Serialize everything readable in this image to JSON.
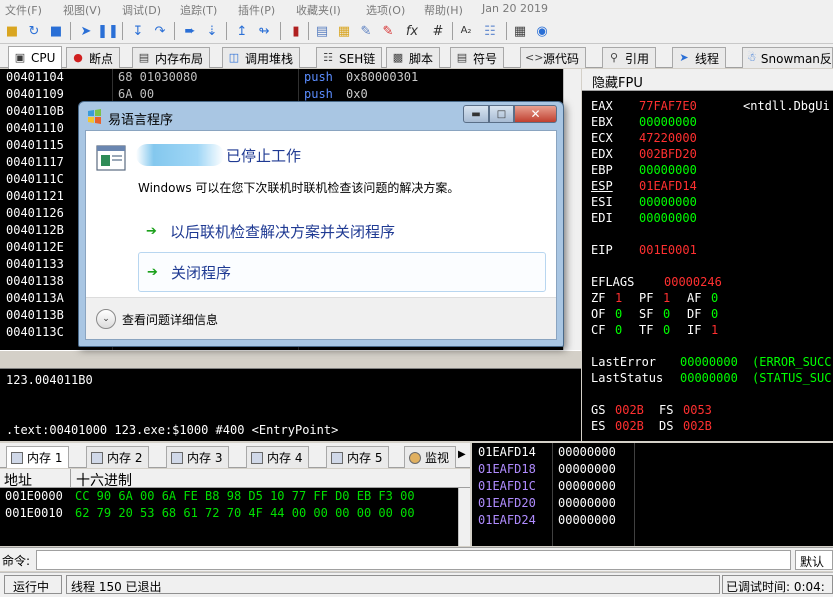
{
  "menu": {
    "items": [
      "文件(F)",
      "视图(V)",
      "调试(D)",
      "追踪(T)",
      "插件(P)",
      "收藏夹(I)",
      "选项(O)",
      "帮助(H)",
      "Jan 20 2019"
    ]
  },
  "tabs": [
    {
      "label": "CPU",
      "icon": "cpu-icon"
    },
    {
      "label": "断点",
      "icon": "breakpoint-icon"
    },
    {
      "label": "内存布局",
      "icon": "memory-map-icon"
    },
    {
      "label": "调用堆栈",
      "icon": "call-stack-icon"
    },
    {
      "label": "SEH链",
      "icon": "seh-icon"
    },
    {
      "label": "脚本",
      "icon": "script-icon"
    },
    {
      "label": "符号",
      "icon": "symbol-icon"
    },
    {
      "label": "源代码",
      "icon": "source-icon"
    },
    {
      "label": "引用",
      "icon": "references-icon"
    },
    {
      "label": "线程",
      "icon": "threads-icon"
    },
    {
      "label": "Snowman反编",
      "icon": "snowman-icon"
    }
  ],
  "disasm": {
    "rows": [
      {
        "addr": "00401104",
        "bytes": "68 01030080",
        "mnemonic": "push",
        "operand": "0x80000301"
      },
      {
        "addr": "00401109",
        "bytes": "6A 00",
        "mnemonic": "push",
        "operand": "0x0"
      },
      {
        "addr": "0040110B",
        "bytes": "",
        "mnemonic": "",
        "operand": ""
      },
      {
        "addr": "00401110",
        "bytes": "",
        "mnemonic": "",
        "operand": ""
      },
      {
        "addr": "00401115",
        "bytes": "",
        "mnemonic": "",
        "operand": ""
      },
      {
        "addr": "00401117",
        "bytes": "",
        "mnemonic": "",
        "operand": ""
      },
      {
        "addr": "0040111C",
        "bytes": "",
        "mnemonic": "",
        "operand": ""
      },
      {
        "addr": "00401121",
        "bytes": "",
        "mnemonic": "",
        "operand": ""
      },
      {
        "addr": "00401126",
        "bytes": "",
        "mnemonic": "",
        "operand": ""
      },
      {
        "addr": "0040112B",
        "bytes": "",
        "mnemonic": "",
        "operand": ""
      },
      {
        "addr": "0040112E",
        "bytes": "",
        "mnemonic": "",
        "operand": ""
      },
      {
        "addr": "00401133",
        "bytes": "",
        "mnemonic": "",
        "operand": ""
      },
      {
        "addr": "00401138",
        "bytes": "",
        "mnemonic": "",
        "operand": ""
      },
      {
        "addr": "0040113A",
        "bytes": "",
        "mnemonic": "",
        "operand": ""
      },
      {
        "addr": "0040113B",
        "bytes": "",
        "mnemonic": "",
        "operand": ""
      },
      {
        "addr": "0040113C",
        "bytes": "",
        "mnemonic": "",
        "operand": ""
      }
    ]
  },
  "info": {
    "line1": "123.004011B0",
    "line2": ".text:00401000 123.exe:$1000 #400 <EntryPoint>"
  },
  "registers": {
    "title": "隐藏FPU",
    "eax": {
      "name": "EAX",
      "value": "77FAF7E0",
      "comment": "<ntdll.DbgUi"
    },
    "ebx": {
      "name": "EBX",
      "value": "00000000"
    },
    "ecx": {
      "name": "ECX",
      "value": "47220000"
    },
    "edx": {
      "name": "EDX",
      "value": "002BFD20"
    },
    "ebp": {
      "name": "EBP",
      "value": "00000000"
    },
    "esp": {
      "name": "ESP",
      "value": "01EAFD14"
    },
    "esi": {
      "name": "ESI",
      "value": "00000000"
    },
    "edi": {
      "name": "EDI",
      "value": "00000000"
    },
    "eip": {
      "name": "EIP",
      "value": "001E0001"
    },
    "eflags": {
      "name": "EFLAGS",
      "value": "00000246"
    },
    "flags": [
      {
        "n": "ZF",
        "v": "1"
      },
      {
        "n": "PF",
        "v": "1"
      },
      {
        "n": "AF",
        "v": "0"
      },
      {
        "n": "OF",
        "v": "0"
      },
      {
        "n": "SF",
        "v": "0"
      },
      {
        "n": "DF",
        "v": "0"
      },
      {
        "n": "CF",
        "v": "0"
      },
      {
        "n": "TF",
        "v": "0"
      },
      {
        "n": "IF",
        "v": "1"
      }
    ],
    "lasterror": {
      "name": "LastError",
      "value": "00000000",
      "comment": "(ERROR_SUCC"
    },
    "laststatus": {
      "name": "LastStatus",
      "value": "00000000",
      "comment": "(STATUS_SUC"
    },
    "gs": {
      "name": "GS",
      "value": "002B"
    },
    "fs": {
      "name": "FS",
      "value": "0053"
    },
    "es": {
      "name": "ES",
      "value": "002B"
    },
    "ds": {
      "name": "DS",
      "value": "002B"
    }
  },
  "memtabs": [
    "内存 1",
    "内存 2",
    "内存 3",
    "内存 4",
    "内存 5",
    "监视"
  ],
  "hex": {
    "col_addr": "地址",
    "col_hex": "十六进制",
    "rows": [
      {
        "addr": "001E0000",
        "bytes": "CC 90 6A 00 6A FE B8 98 D5 10 77 FF D0 EB F3 00"
      },
      {
        "addr": "001E0010",
        "bytes": "62 79 20 53 68 61 72 70 4F 44 00 00 00 00 00 00"
      }
    ]
  },
  "stack": {
    "rows": [
      {
        "addr": "01EAFD14",
        "value": "00000000"
      },
      {
        "addr": "01EAFD18",
        "value": "00000000"
      },
      {
        "addr": "01EAFD1C",
        "value": "00000000"
      },
      {
        "addr": "01EAFD20",
        "value": "00000000"
      },
      {
        "addr": "01EAFD24",
        "value": "00000000"
      }
    ]
  },
  "command": {
    "label": "命令:",
    "value": "",
    "default_label": "默认"
  },
  "status": {
    "state": "运行中",
    "message": "线程 150 已退出",
    "time": "已调试时间: 0:04:"
  },
  "dialog": {
    "title": "易语言程序",
    "heading": "已停止工作",
    "description": "Windows 可以在您下次联机时联机检查该问题的解决方案。",
    "option1": "以后联机检查解决方案并关闭程序",
    "option2": "关闭程序",
    "details": "查看问题详细信息"
  }
}
